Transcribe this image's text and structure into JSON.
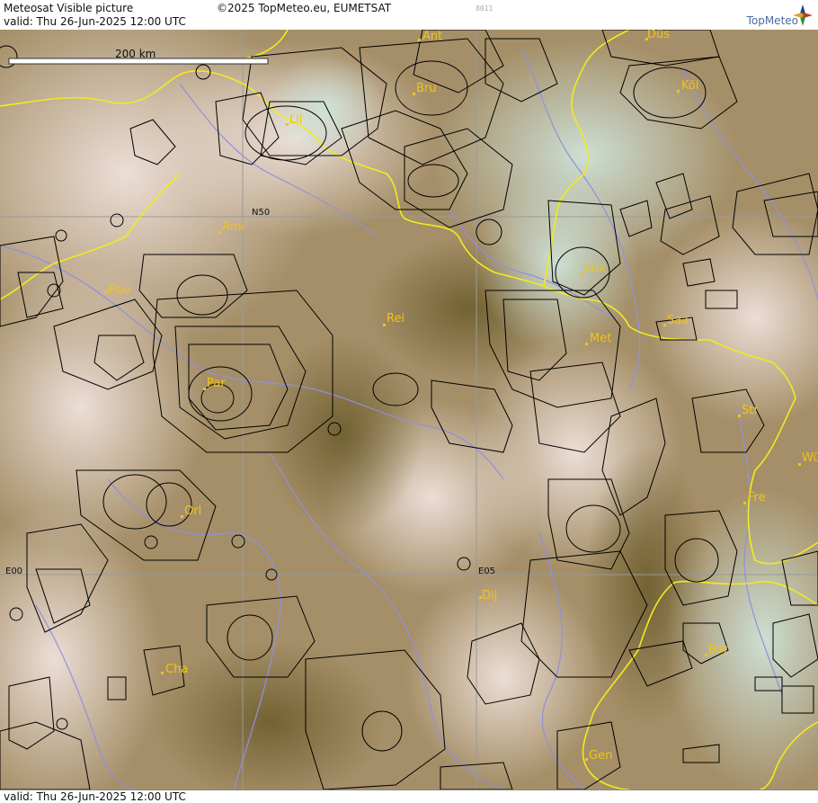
{
  "header": {
    "title": "Meteosat Visible picture",
    "valid": "valid:  Thu  26-Jun-2025  12:00 UTC",
    "copyright": "©2025 TopMeteo.eu, EUMETSAT",
    "code": "8011",
    "brand": "TopMeteo"
  },
  "footer": {
    "valid": "valid:  Thu  26-Jun-2025  12:00 UTC"
  },
  "map": {
    "scale_label": "200 km",
    "grid_labels": {
      "n50": "N50",
      "e00": "E00",
      "e05": "E05"
    },
    "cities": [
      {
        "id": "ant",
        "name": "Ant"
      },
      {
        "id": "dus",
        "name": "Düs"
      },
      {
        "id": "bru",
        "name": "Bru"
      },
      {
        "id": "kol",
        "name": "Köl"
      },
      {
        "id": "lil",
        "name": "Lil"
      },
      {
        "id": "ami",
        "name": "Ami"
      },
      {
        "id": "rou",
        "name": "Rou"
      },
      {
        "id": "lux",
        "name": "Lux"
      },
      {
        "id": "rei",
        "name": "Rei"
      },
      {
        "id": "saa",
        "name": "Saa"
      },
      {
        "id": "met",
        "name": "Met"
      },
      {
        "id": "par",
        "name": "Par"
      },
      {
        "id": "str",
        "name": "Str"
      },
      {
        "id": "orl",
        "name": "Orl"
      },
      {
        "id": "fre",
        "name": "Fre"
      },
      {
        "id": "wu",
        "name": "Wü"
      },
      {
        "id": "dij",
        "name": "Dij"
      },
      {
        "id": "ber",
        "name": "Ber"
      },
      {
        "id": "cha",
        "name": "Cha"
      },
      {
        "id": "gen",
        "name": "Gen"
      }
    ],
    "colors": {
      "city_label": "#f0c418",
      "border": "#f2ea1e",
      "river": "#8f90e0",
      "airspace": "#000000",
      "grid": "#9a9a9a"
    }
  }
}
